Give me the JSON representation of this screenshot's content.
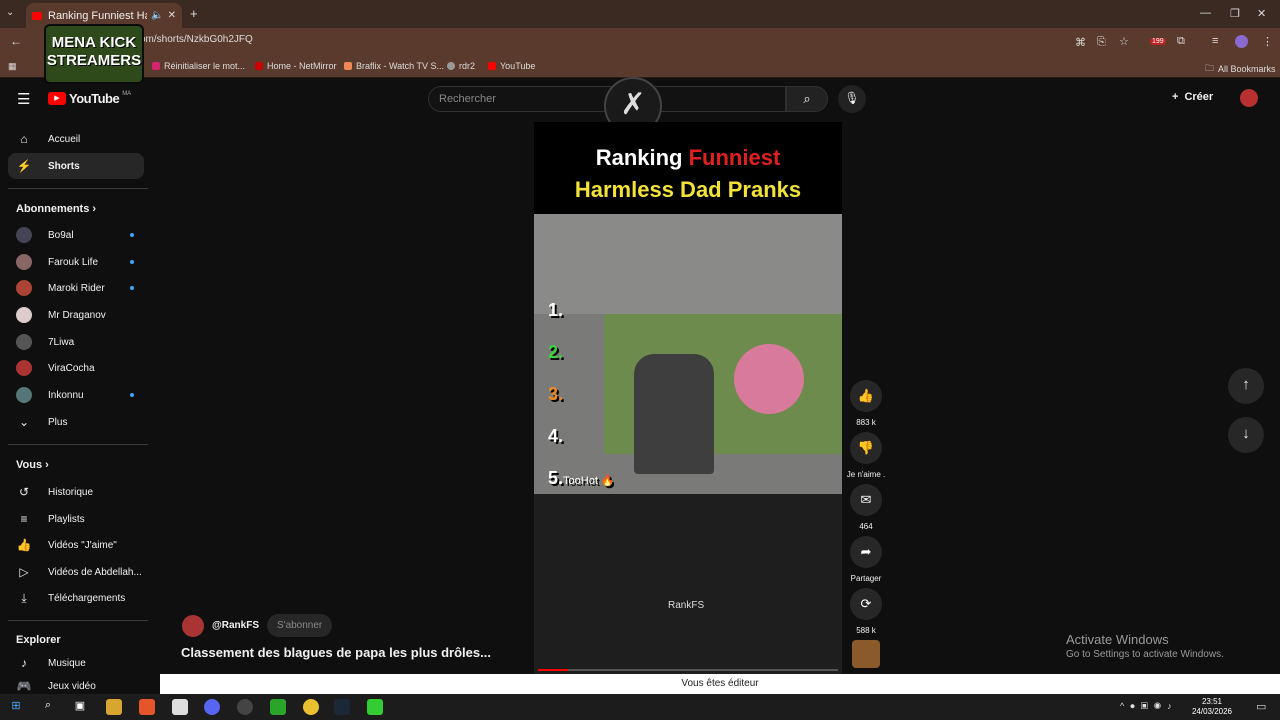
{
  "browser": {
    "tab_title": "Ranking Funniest Harmless",
    "url": "om/shorts/NzkbG0h2JFQ",
    "bookmarks": [
      "Réinitialiser le mot...",
      "Home - NetMirror",
      "Braflix - Watch TV S...",
      "rdr2",
      "YouTube"
    ],
    "all_bookmarks": "All Bookmarks",
    "badge": "199"
  },
  "overlay_logo": {
    "line1": "MENA KICK",
    "line2": "STREAMERS"
  },
  "youtube": {
    "logo_text": "YouTube",
    "logo_sup": "MA",
    "search_placeholder": "Rechercher",
    "create_label": "Créer"
  },
  "sidebar": {
    "main": [
      "Accueil",
      "Shorts"
    ],
    "subs_header": "Abonnements",
    "subs": [
      "Bo9al",
      "Farouk Life",
      "Maroki Rider",
      "Mr Draganov",
      "7Liwa",
      "ViraCocha",
      "Inkonnu"
    ],
    "more": "Plus",
    "you_header": "Vous",
    "you": [
      "Historique",
      "Playlists",
      "Vidéos \"J'aime\"",
      "Vidéos de Abdellah...",
      "Téléchargements"
    ],
    "explore_header": "Explorer",
    "explore": [
      "Musique",
      "Jeux vidéo"
    ]
  },
  "short": {
    "title_white": "Ranking ",
    "title_red": "Funniest",
    "title_line2": "Harmless Dad Pranks",
    "ranks": [
      "1.",
      "2.",
      "3.",
      "4.",
      "5."
    ],
    "rank5_label": "TooHot 🔥",
    "watermark": "RankFS"
  },
  "actions": {
    "likes": "883 k",
    "dislike": "Je n'aime .",
    "comments": "464",
    "share": "Partager",
    "remix": "588 k"
  },
  "channel": {
    "handle": "@RankFS",
    "subscribe": "S'abonner"
  },
  "video_title": "Classement des blagues de papa les plus drôles...",
  "windows": {
    "activate": "Activate Windows",
    "activate_sub": "Go to Settings to activate Windows.",
    "time": "23:51",
    "date": "24/03/2026"
  },
  "editor_bar": "Vous êtes éditeur"
}
